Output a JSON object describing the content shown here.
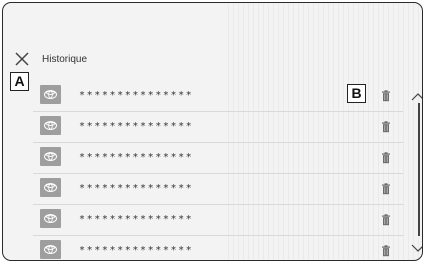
{
  "header": {
    "title": "Historique"
  },
  "labels": {
    "a": "A",
    "b": "B"
  },
  "icons": {
    "close": "close-icon",
    "entry": "toyota-logo-icon",
    "delete": "trash-icon",
    "scroll_up": "chevron-up-icon",
    "scroll_down": "chevron-down-icon"
  },
  "history": {
    "items": [
      {
        "text": "***************"
      },
      {
        "text": "***************"
      },
      {
        "text": "***************"
      },
      {
        "text": "***************"
      },
      {
        "text": "***************"
      },
      {
        "text": "***************"
      }
    ]
  },
  "colors": {
    "background": "#f3f3f3",
    "icon_fill": "#9e9e9e",
    "border": "#2b2b2b"
  }
}
